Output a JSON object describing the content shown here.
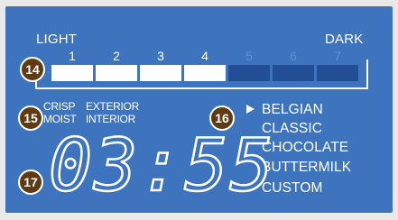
{
  "header": {
    "left_label": "LIGHT",
    "right_label": "DARK"
  },
  "levels": [
    {
      "number": "1",
      "active": true
    },
    {
      "number": "2",
      "active": true
    },
    {
      "number": "3",
      "active": true
    },
    {
      "number": "4",
      "active": true
    },
    {
      "number": "5",
      "active": false
    },
    {
      "number": "6",
      "active": false
    },
    {
      "number": "7",
      "active": false
    }
  ],
  "callouts": {
    "c14": "14",
    "c15": "15",
    "c16": "16",
    "c17": "17"
  },
  "texture": {
    "crisp": "CRISP",
    "exterior": "EXTERIOR",
    "moist": "MOIST",
    "interior": "INTERIOR"
  },
  "menu": {
    "selected_index": 0,
    "items": [
      "BELGIAN",
      "CLASSIC",
      "CHOCOLATE",
      "BUTTERMILK",
      "CUSTOM"
    ]
  },
  "timer": {
    "display": "03:55"
  },
  "colors": {
    "lcd_bg": "#3d74bd",
    "inactive_bar": "#224e95",
    "badge": "#5e3b14",
    "text": "#ffffff"
  }
}
